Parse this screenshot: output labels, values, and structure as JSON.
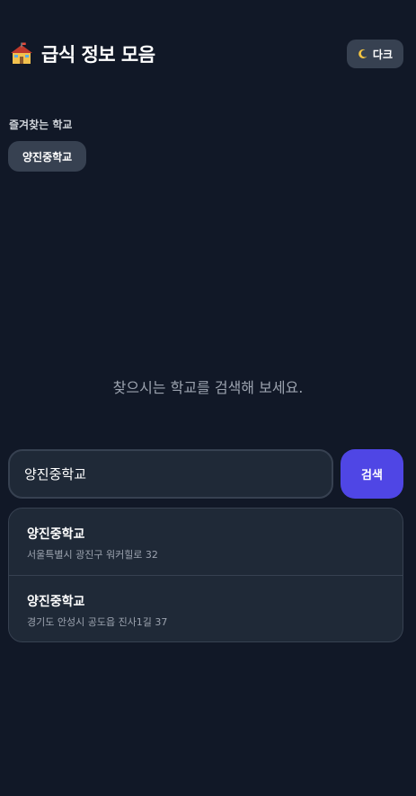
{
  "header": {
    "title": "급식 정보 모음",
    "icon": "school-icon",
    "theme_button": {
      "icon": "moon-icon",
      "label": "다크"
    }
  },
  "favorites": {
    "label": "즐겨찾는 학교",
    "items": [
      {
        "label": "양진중학교"
      }
    ]
  },
  "main": {
    "empty_message": "찾으시는 학교를 검색해 보세요."
  },
  "search": {
    "value": "양진중학교",
    "button_label": "검색"
  },
  "results": [
    {
      "name": "양진중학교",
      "address": "서울특별시 광진구 워커힐로 32"
    },
    {
      "name": "양진중학교",
      "address": "경기도 안성시 공도읍 진사1길 37"
    }
  ],
  "colors": {
    "background": "#111827",
    "surface": "#1f2937",
    "chip": "#374151",
    "accent": "#4f46e5"
  }
}
